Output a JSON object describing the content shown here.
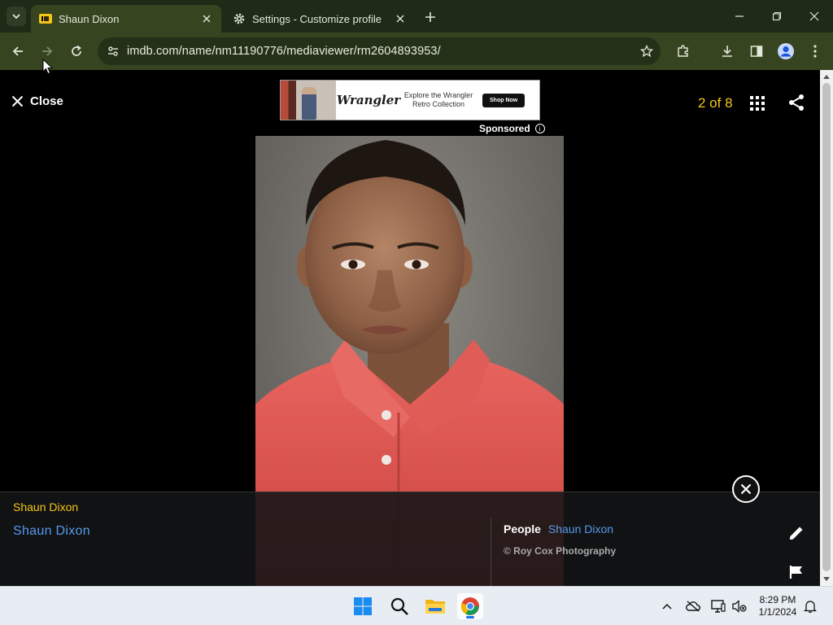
{
  "browser": {
    "tabs": [
      {
        "title": "Shaun Dixon",
        "favicon": "imdb-icon",
        "active": true
      },
      {
        "title": "Settings - Customize profile",
        "favicon": "gear-icon",
        "active": false
      }
    ],
    "url": "imdb.com/name/nm11190776/mediaviewer/rm2604893953/"
  },
  "viewer": {
    "close_label": "Close",
    "counter": "2 of 8",
    "ad": {
      "brand": "Wrangler",
      "tagline": "Explore the Wrangler Retro Collection",
      "cta": "Shop Now",
      "sponsored_label": "Sponsored"
    }
  },
  "caption": {
    "title": "Shaun Dixon",
    "link": "Shaun Dixon",
    "people_label": "People",
    "people_value": "Shaun Dixon",
    "copyright": "© Roy Cox Photography"
  },
  "taskbar": {
    "time": "8:29 PM",
    "date": "1/1/2024"
  },
  "colors": {
    "imdb_yellow": "#f5c518",
    "link_blue": "#5799ef",
    "chrome_frame": "#1e2b17",
    "chrome_toolbar": "#36451f"
  }
}
